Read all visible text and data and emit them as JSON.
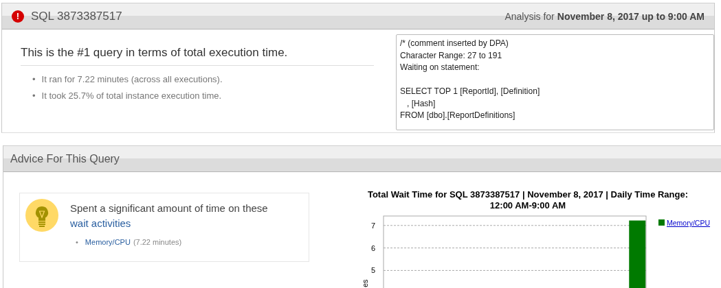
{
  "query_panel": {
    "icon": "!",
    "title": "SQL 3873387517",
    "analysis_prefix": "Analysis for",
    "analysis_date": "November 8, 2017 up to 9:00 AM",
    "headline": "This is the #1 query in terms of total execution time.",
    "bullet_marker": "•",
    "bullets": [
      "It ran for 7.22 minutes (across all executions).",
      "It took 25.7% of total instance execution time."
    ],
    "sql_blocks": [
      [
        "/* (comment inserted by DPA)",
        "Character Range: 27 to 191",
        "Waiting on statement:"
      ],
      [
        "SELECT TOP 1 [ReportId], [Definition]",
        "   , [Hash]",
        "FROM [dbo].[ReportDefinitions]"
      ]
    ]
  },
  "advice_panel": {
    "title": "Advice For This Query",
    "message": "Spent a significant amount of time on these",
    "message_link": "wait activities",
    "items": [
      {
        "marker": "•",
        "link": "Memory/CPU",
        "detail": "(7.22 minutes)"
      }
    ],
    "chart_data": {
      "type": "bar",
      "title": "Total Wait Time for SQL 3873387517 | November 8, 2017 | Daily Time Range: 12:00 AM-9:00 AM",
      "ylabel": "es",
      "ylim": [
        4.22,
        7.42
      ],
      "yticks": [
        5,
        6,
        7
      ],
      "grid": true,
      "series": [
        {
          "name": "Memory/CPU",
          "color": "#007a00",
          "values": [
            null,
            null,
            null,
            null,
            null,
            null,
            null,
            null,
            null,
            null,
            null,
            null,
            null,
            null,
            7.22
          ]
        }
      ]
    }
  }
}
